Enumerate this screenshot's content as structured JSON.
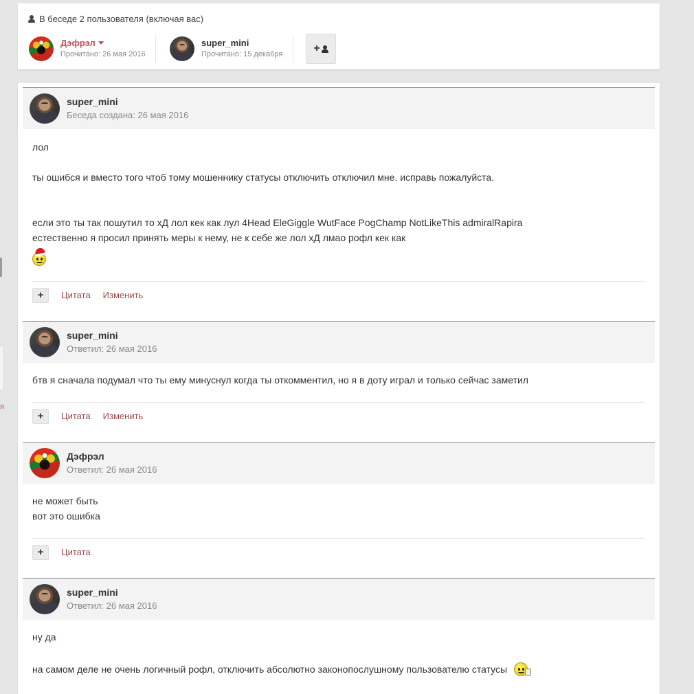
{
  "participants": {
    "header": "В беседе 2 пользователя (включая вас)",
    "members": [
      {
        "name": "Дэфрэл",
        "read": "Прочитано: 26 мая 2016"
      },
      {
        "name": "super_mini",
        "read": "Прочитано: 15 декабря"
      }
    ]
  },
  "left_sidebar": {
    "cut_char": "я"
  },
  "actions": {
    "quote": "Цитата",
    "edit": "Изменить",
    "reputation": "+"
  },
  "posts": [
    {
      "author": "super_mini",
      "date": "Беседа создана: 26 мая 2016",
      "lines": [
        "лол",
        "ты ошибся и вместо того чтоб тому мошеннику статусы отключить отключил мне. исправь пожалуйста.",
        "если это ты так пошутил то хД лол кек как лул 4Head EleGiggle WutFace PogChamp NotLikeThis admiralRapira",
        "естественно я просил принять меры к нему, не к себе же лол хД лмао рофл кек как"
      ],
      "emoji": "santa-smiley-icon"
    },
    {
      "author": "super_mini",
      "date": "Ответил: 26 мая 2016",
      "lines": [
        "бтв я сначала подумал что ты ему минуснул когда ты откомментил, но я в доту играл и только сейчас заметил"
      ]
    },
    {
      "author": "Дэфрэл",
      "date": "Ответил: 26 мая 2016",
      "lines": [
        "не может быть",
        "вот это ошибка"
      ]
    },
    {
      "author": "super_mini",
      "date": "Ответил: 26 мая 2016",
      "lines": [
        "ну да",
        "на самом деле не очень логичный рофл, отключить абсолютно законопослушному пользователю статусы"
      ],
      "emoji": "tea-smiley-icon"
    }
  ]
}
